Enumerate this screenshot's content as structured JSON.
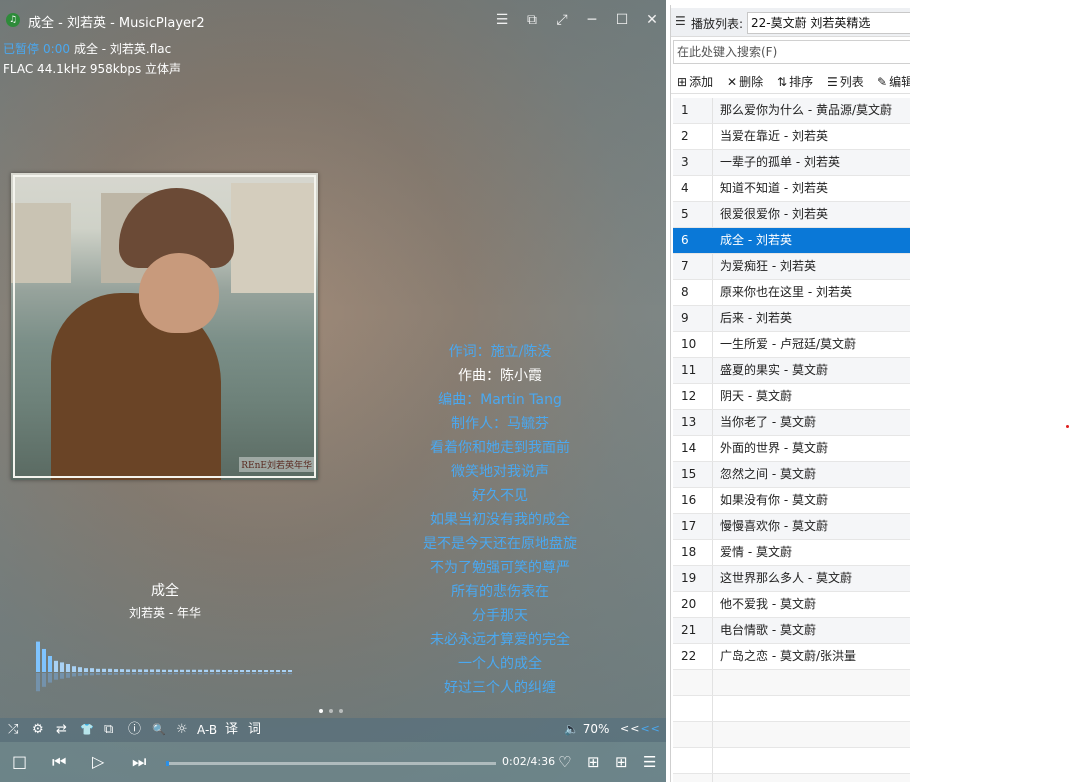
{
  "window": {
    "title": "成全 - 刘若英 - MusicPlayer2",
    "app_icon": "♫"
  },
  "titlebar_buttons": [
    "☰",
    "⧉",
    "⤢",
    "─",
    "☐",
    "✕"
  ],
  "status": {
    "state": "已暂停",
    "time": "0:00",
    "file": "成全 - 刘若英.flac",
    "format": "FLAC 44.1kHz 958kbps 立体声"
  },
  "cover_text": "REnE刘若英年华",
  "now_playing": {
    "title": "成全",
    "artist_album": "刘若英 - 年华"
  },
  "lyrics": [
    "作词：施立/陈没",
    "作曲：陈小霞",
    "编曲：Martin Tang",
    "制作人：马毓芬",
    "看着你和她走到我面前",
    "微笑地对我说声",
    "好久不见",
    "如果当初没有我的成全",
    "是不是今天还在原地盘旋",
    "不为了勉强可笑的尊严",
    "所有的悲伤表在",
    "分手那天",
    "未必永远才算爱的完全",
    "一个人的成全",
    "好过三个人的纠缠"
  ],
  "current_lyric_index": 1,
  "toolbar": {
    "icons": [
      "⤮",
      "⚙",
      "⇄",
      "👕",
      "⧉",
      "ⓘ",
      "🔍",
      "☼"
    ],
    "ab": "A-B",
    "translate": "译",
    "lyric": "词",
    "volume": "🔈 70%",
    "vol_left": "<<",
    "vol_right": "<<"
  },
  "controls": {
    "stop": "□",
    "prev": "⏮",
    "play": "▷",
    "next": "⏭",
    "time": "0:02/4:36",
    "heart": "♡",
    "add": "⊞",
    "grid": "⊞",
    "list": "☰"
  },
  "progress": 0.007,
  "spectrum": [
    0.95,
    0.72,
    0.5,
    0.35,
    0.3,
    0.25,
    0.18,
    0.15,
    0.12,
    0.12,
    0.1,
    0.1,
    0.1,
    0.09,
    0.09,
    0.08,
    0.08,
    0.08,
    0.08,
    0.08,
    0.08,
    0.07,
    0.07,
    0.07,
    0.07,
    0.07,
    0.07,
    0.07,
    0.07,
    0.07,
    0.07,
    0.06,
    0.06,
    0.06,
    0.06,
    0.06,
    0.06,
    0.06,
    0.06,
    0.05,
    0.05,
    0.05,
    0.05
  ],
  "playlist": {
    "label": "播放列表:",
    "name": "22-莫文蔚 刘若英精选",
    "search_placeholder": "在此处键入搜索(F)",
    "tools": [
      {
        "icon": "⊞",
        "label": "添加"
      },
      {
        "icon": "✕",
        "label": "删除"
      },
      {
        "icon": "⇅",
        "label": "排序"
      },
      {
        "icon": "☰",
        "label": "列表"
      },
      {
        "icon": "✎",
        "label": "编辑"
      }
    ],
    "items": [
      {
        "num": "1",
        "title": "那么爱你为什么 - 黄品源/莫文蔚"
      },
      {
        "num": "2",
        "title": "当爱在靠近 - 刘若英"
      },
      {
        "num": "3",
        "title": "一辈子的孤单 - 刘若英"
      },
      {
        "num": "4",
        "title": "知道不知道 - 刘若英"
      },
      {
        "num": "5",
        "title": "很爱很爱你 - 刘若英"
      },
      {
        "num": "6",
        "title": "成全 - 刘若英"
      },
      {
        "num": "7",
        "title": "为爱痴狂 - 刘若英"
      },
      {
        "num": "8",
        "title": "原来你也在这里 - 刘若英"
      },
      {
        "num": "9",
        "title": "后来 - 刘若英"
      },
      {
        "num": "10",
        "title": "一生所爱 - 卢冠廷/莫文蔚"
      },
      {
        "num": "11",
        "title": "盛夏的果实 - 莫文蔚"
      },
      {
        "num": "12",
        "title": "阴天 - 莫文蔚"
      },
      {
        "num": "13",
        "title": "当你老了 - 莫文蔚"
      },
      {
        "num": "14",
        "title": "外面的世界 - 莫文蔚"
      },
      {
        "num": "15",
        "title": "忽然之间 - 莫文蔚"
      },
      {
        "num": "16",
        "title": "如果没有你 - 莫文蔚"
      },
      {
        "num": "17",
        "title": "慢慢喜欢你 - 莫文蔚"
      },
      {
        "num": "18",
        "title": "爱情 - 莫文蔚"
      },
      {
        "num": "19",
        "title": "这世界那么多人 - 莫文蔚"
      },
      {
        "num": "20",
        "title": "他不爱我 - 莫文蔚"
      },
      {
        "num": "21",
        "title": "电台情歌 - 莫文蔚"
      },
      {
        "num": "22",
        "title": "广岛之恋 - 莫文蔚/张洪量"
      }
    ],
    "active_index": 5,
    "empty_rows": 5
  }
}
